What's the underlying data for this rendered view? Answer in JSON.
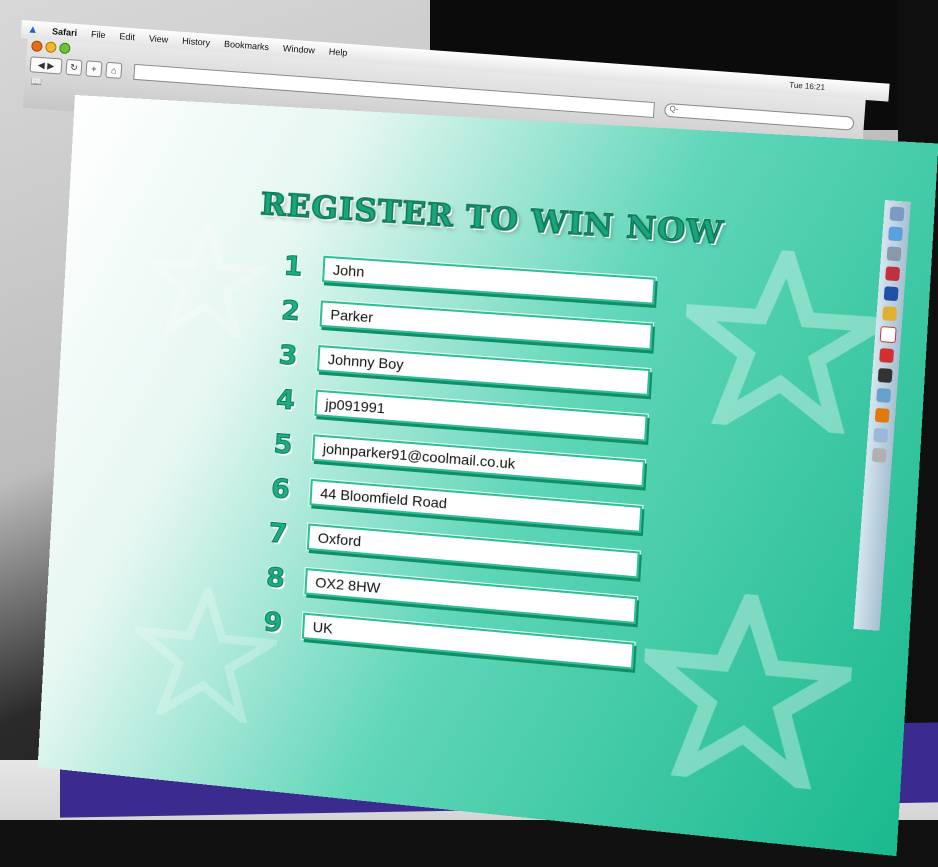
{
  "menubar": {
    "items": [
      "Safari",
      "File",
      "Edit",
      "View",
      "History",
      "Bookmarks",
      "Window",
      "Help"
    ],
    "clock": "Tue 16:21"
  },
  "toolbar": {
    "search_placeholder": "Q-"
  },
  "form": {
    "title": "REGISTER TO WIN NOW",
    "fields": [
      {
        "number": "1",
        "value": "John"
      },
      {
        "number": "2",
        "value": "Parker"
      },
      {
        "number": "3",
        "value": "Johnny Boy"
      },
      {
        "number": "4",
        "value": "jp091991"
      },
      {
        "number": "5",
        "value": "johnparker91@coolmail.co.uk"
      },
      {
        "number": "6",
        "value": "44 Bloomfield Road"
      },
      {
        "number": "7",
        "value": "Oxford"
      },
      {
        "number": "8",
        "value": "OX2 8HW"
      },
      {
        "number": "9",
        "value": "UK"
      }
    ]
  },
  "colors": {
    "accent": "#1ab98e",
    "frame": "#3c2b8f"
  },
  "dock": {
    "icons": [
      "finder-icon",
      "safari-icon",
      "system-icon",
      "app-icon",
      "photoshop-icon",
      "pencil-icon",
      "calendar-icon",
      "acrobat-icon",
      "text-icon",
      "network-icon",
      "illustrator-icon",
      "folder-icon",
      "trash-icon"
    ]
  }
}
